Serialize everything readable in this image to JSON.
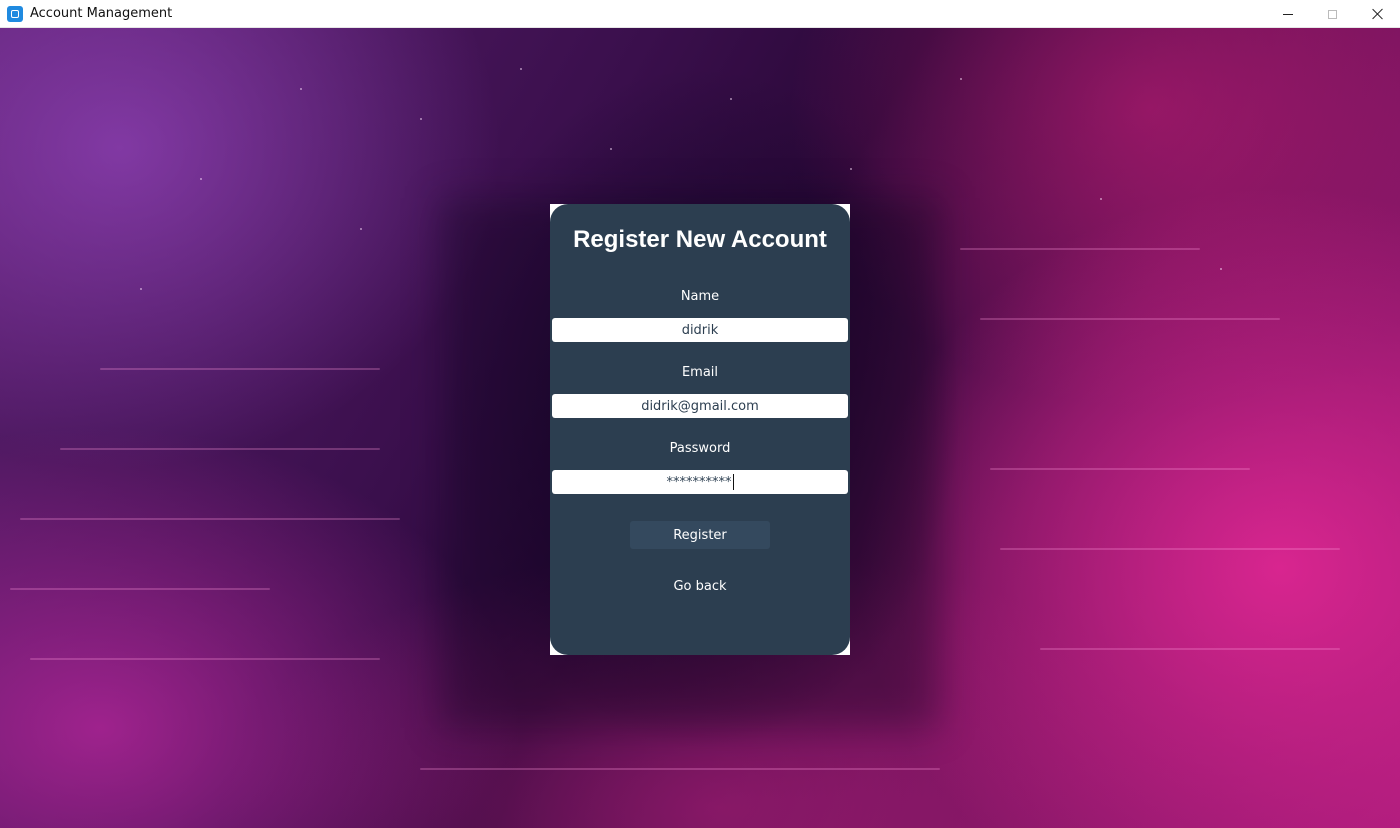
{
  "window": {
    "title": "Account Management"
  },
  "form": {
    "title": "Register New Account",
    "name_label": "Name",
    "name_value": "didrik",
    "email_label": "Email",
    "email_value": "didrik@gmail.com",
    "password_label": "Password",
    "password_value": "**********",
    "register_label": "Register",
    "go_back_label": "Go back"
  },
  "colors": {
    "card": "#2c3e50",
    "button": "#34495e",
    "text": "#ffffff"
  }
}
